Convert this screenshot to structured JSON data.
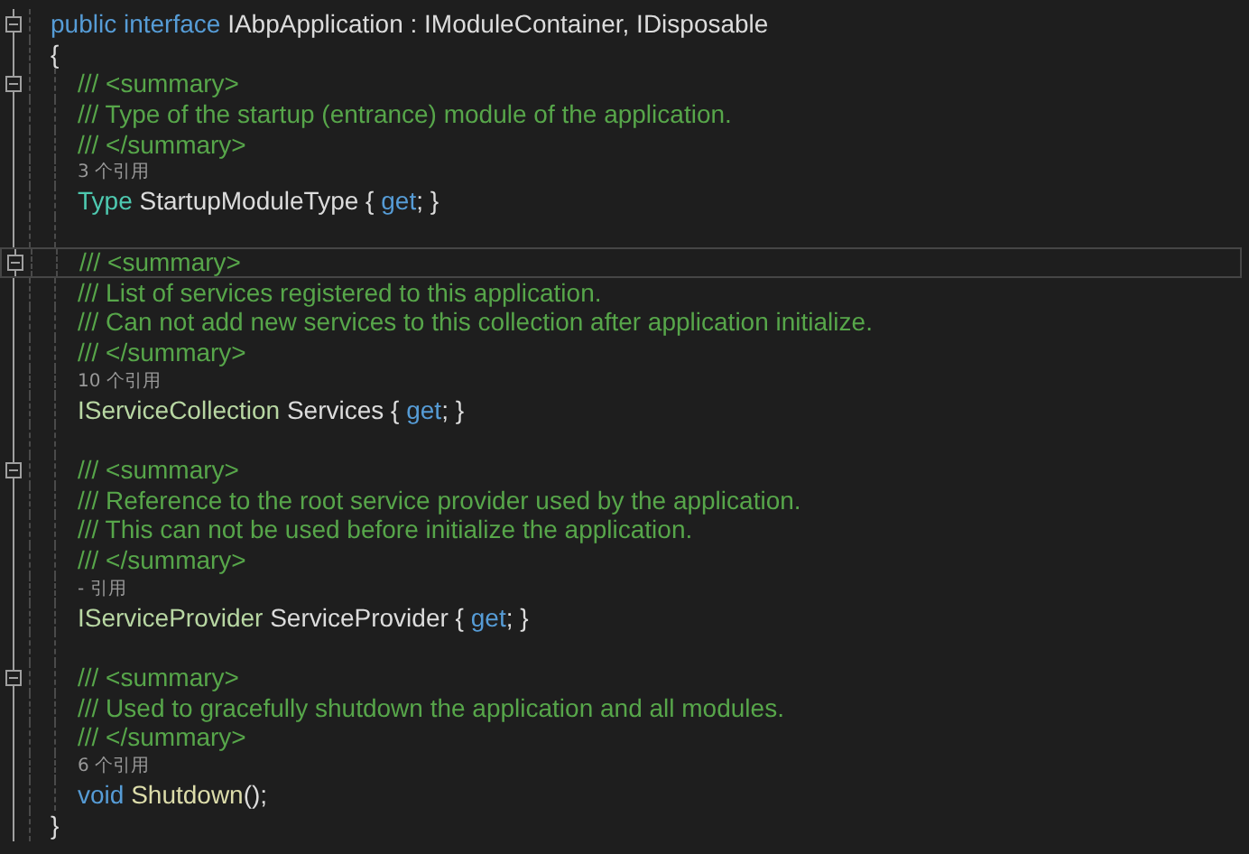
{
  "declaration": {
    "collapsible": true,
    "tokens": [
      {
        "text": "public",
        "kind": "keyword"
      },
      {
        "text": " interface",
        "kind": "keyword"
      },
      {
        "text": " IAbpApplication : IModuleContainer, IDisposable",
        "kind": "plain"
      }
    ],
    "open": "{",
    "close": "}",
    "members": [
      {
        "collapsible": true,
        "doc": [
          {
            "text": "/// <summary>",
            "highlighted": false
          },
          {
            "text": "/// Type of the startup (entrance) module of the application.",
            "highlighted": false
          },
          {
            "text": "/// </summary>",
            "highlighted": false
          }
        ],
        "references": "3 个引用",
        "signature": [
          {
            "text": "Type",
            "kind": "type"
          },
          {
            "text": " StartupModuleType { ",
            "kind": "plain"
          },
          {
            "text": "get",
            "kind": "keyword"
          },
          {
            "text": "; }",
            "kind": "plain"
          }
        ]
      },
      {
        "collapsible": true,
        "doc": [
          {
            "text": "/// <summary>",
            "highlighted": true
          },
          {
            "text": "/// List of services registered to this application.",
            "highlighted": false
          },
          {
            "text": "/// Can not add new services to this collection after application initialize.",
            "highlighted": false
          },
          {
            "text": "/// </summary>",
            "highlighted": false
          }
        ],
        "references": "10 个引用",
        "signature": [
          {
            "text": "IServiceCollection",
            "kind": "interface"
          },
          {
            "text": " Services { ",
            "kind": "plain"
          },
          {
            "text": "get",
            "kind": "keyword"
          },
          {
            "text": "; }",
            "kind": "plain"
          }
        ]
      },
      {
        "collapsible": true,
        "doc": [
          {
            "text": "/// <summary>",
            "highlighted": false
          },
          {
            "text": "/// Reference to the root service provider used by the application.",
            "highlighted": false
          },
          {
            "text": "/// This can not be used before initialize the application.",
            "highlighted": false
          },
          {
            "text": "/// </summary>",
            "highlighted": false
          }
        ],
        "references": "- 引用",
        "signature": [
          {
            "text": "IServiceProvider",
            "kind": "interface"
          },
          {
            "text": " ServiceProvider { ",
            "kind": "plain"
          },
          {
            "text": "get",
            "kind": "keyword"
          },
          {
            "text": "; }",
            "kind": "plain"
          }
        ]
      },
      {
        "collapsible": true,
        "doc": [
          {
            "text": "/// <summary>",
            "highlighted": false
          },
          {
            "text": "/// Used to gracefully shutdown the application and all modules.",
            "highlighted": false
          },
          {
            "text": "/// </summary>",
            "highlighted": false
          }
        ],
        "references": "6 个引用",
        "signature": [
          {
            "text": "void",
            "kind": "keyword"
          },
          {
            "text": " Shutdown",
            "kind": "method"
          },
          {
            "text": "();",
            "kind": "plain"
          }
        ]
      }
    ]
  }
}
